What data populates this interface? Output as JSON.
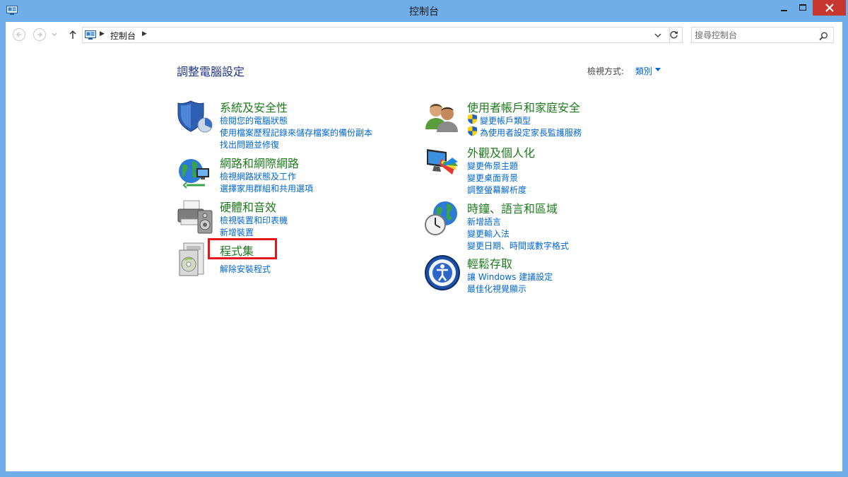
{
  "window": {
    "title": "控制台"
  },
  "nav": {
    "back_icon": "back-arrow-icon",
    "forward_icon": "forward-arrow-icon",
    "up_icon": "up-arrow-icon",
    "breadcrumb": "控制台",
    "search_placeholder": "搜尋控制台"
  },
  "header": {
    "title": "調整電腦設定",
    "view_by_label": "檢視方式:",
    "view_by_value": "類別"
  },
  "categories": [
    {
      "title": "系統及安全性",
      "icon": "security-shield-icon",
      "links": [
        "檢閱您的電腦狀態",
        "使用檔案歷程記錄來儲存檔案的備份副本",
        "找出問題並修復"
      ]
    },
    {
      "title": "網路和網際網路",
      "icon": "network-globe-icon",
      "links": [
        "檢視網路狀態及工作",
        "選擇家用群組和共用選項"
      ]
    },
    {
      "title": "硬體和音效",
      "icon": "printer-speaker-icon",
      "links": [
        "檢視裝置和印表機",
        "新增裝置"
      ]
    },
    {
      "title": "程式集",
      "icon": "programs-disc-icon",
      "links": [
        "解除安裝程式"
      ]
    },
    {
      "title": "使用者帳戶和家庭安全",
      "icon": "users-icon",
      "links": [
        "變更帳戶類型",
        "為使用者設定家長監護服務"
      ]
    },
    {
      "title": "外觀及個人化",
      "icon": "appearance-monitor-icon",
      "links": [
        "變更佈景主題",
        "變更桌面背景",
        "調整螢幕解析度"
      ]
    },
    {
      "title": "時鐘、語言和區域",
      "icon": "clock-globe-icon",
      "links": [
        "新增語言",
        "變更輸入法",
        "變更日期、時間或數字格式"
      ]
    },
    {
      "title": "輕鬆存取",
      "icon": "ease-of-access-icon",
      "links": [
        "讓 Windows 建議設定",
        "最佳化視覺顯示"
      ]
    }
  ],
  "colors": {
    "title_bar": "#6faee8",
    "category_title": "#1e7a1e",
    "link": "#0066cc",
    "heading": "#1e3287",
    "highlight_box": "#e8141c",
    "close_button": "#c7372f"
  }
}
